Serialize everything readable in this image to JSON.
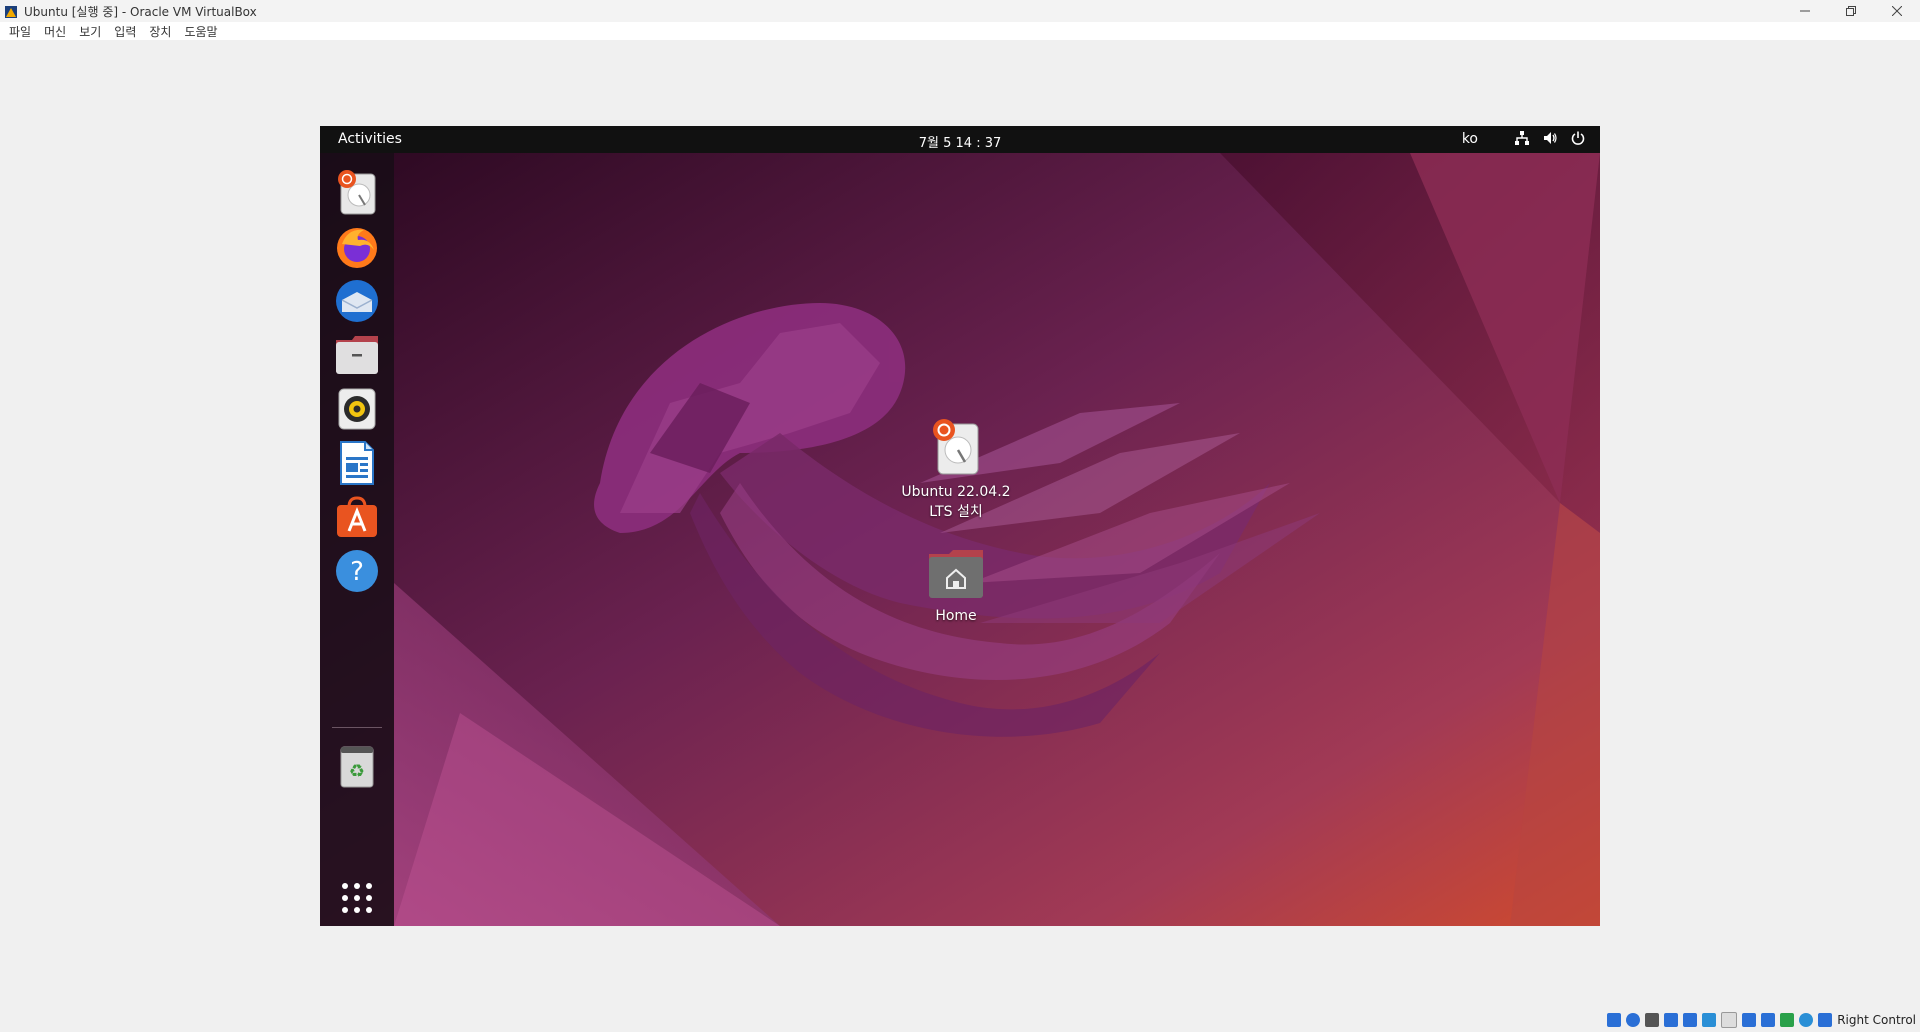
{
  "window": {
    "title": "Ubuntu [실행 중] - Oracle VM VirtualBox",
    "controls": [
      "minimize-icon",
      "restore-icon",
      "close-icon"
    ]
  },
  "menubar": {
    "items": [
      "파일",
      "머신",
      "보기",
      "입력",
      "장치",
      "도움말"
    ]
  },
  "guest": {
    "topbar": {
      "activities": "Activities",
      "clock": "7월 5  14 : 37",
      "language": "ko",
      "tray_icons": [
        "network-icon",
        "volume-icon",
        "power-icon"
      ]
    },
    "dock": {
      "items": [
        {
          "name": "install-ubuntu",
          "icon": "installer-disk-icon"
        },
        {
          "name": "firefox",
          "icon": "firefox-icon"
        },
        {
          "name": "thunderbird",
          "icon": "thunderbird-icon"
        },
        {
          "name": "files",
          "icon": "files-icon"
        },
        {
          "name": "rhythmbox",
          "icon": "rhythmbox-icon"
        },
        {
          "name": "libreoffice-writer",
          "icon": "writer-icon"
        },
        {
          "name": "ubuntu-software",
          "icon": "software-icon"
        },
        {
          "name": "help",
          "icon": "help-icon"
        },
        {
          "name": "trash",
          "icon": "trash-icon"
        },
        {
          "name": "show-applications",
          "icon": "app-grid-icon"
        }
      ]
    },
    "desktop_icons": [
      {
        "label_line1": "Ubuntu 22.04.2",
        "label_line2": "LTS 설치",
        "icon": "installer-disk-icon"
      },
      {
        "label_line1": "Home",
        "icon": "home-folder-icon"
      }
    ]
  },
  "statusbar": {
    "host_key": "Right Control",
    "icons": [
      "hard-disk-icon",
      "optical-drive-icon",
      "audio-icon",
      "network-adapter-icon",
      "usb-icon",
      "shared-folders-icon",
      "display-icon",
      "video-capture-icon",
      "recording-icon",
      "cpu-icon",
      "mouse-integration-icon",
      "keyboard-icon"
    ],
    "icon_colors": [
      "#2a6fd6",
      "#2a6fd6",
      "#555555",
      "#2a6fd6",
      "#2a6fd6",
      "#2a8fd6",
      "#dddddd",
      "#2a6fd6",
      "#2a6fd6",
      "#2aa14a",
      "#2a8fd6",
      "#2a6fd6"
    ]
  },
  "colors": {
    "wallpaper_dark": "#2c0a22",
    "wallpaper_mid": "#7a2a55",
    "wallpaper_orange": "#c4463a",
    "accent": "#e95420"
  }
}
